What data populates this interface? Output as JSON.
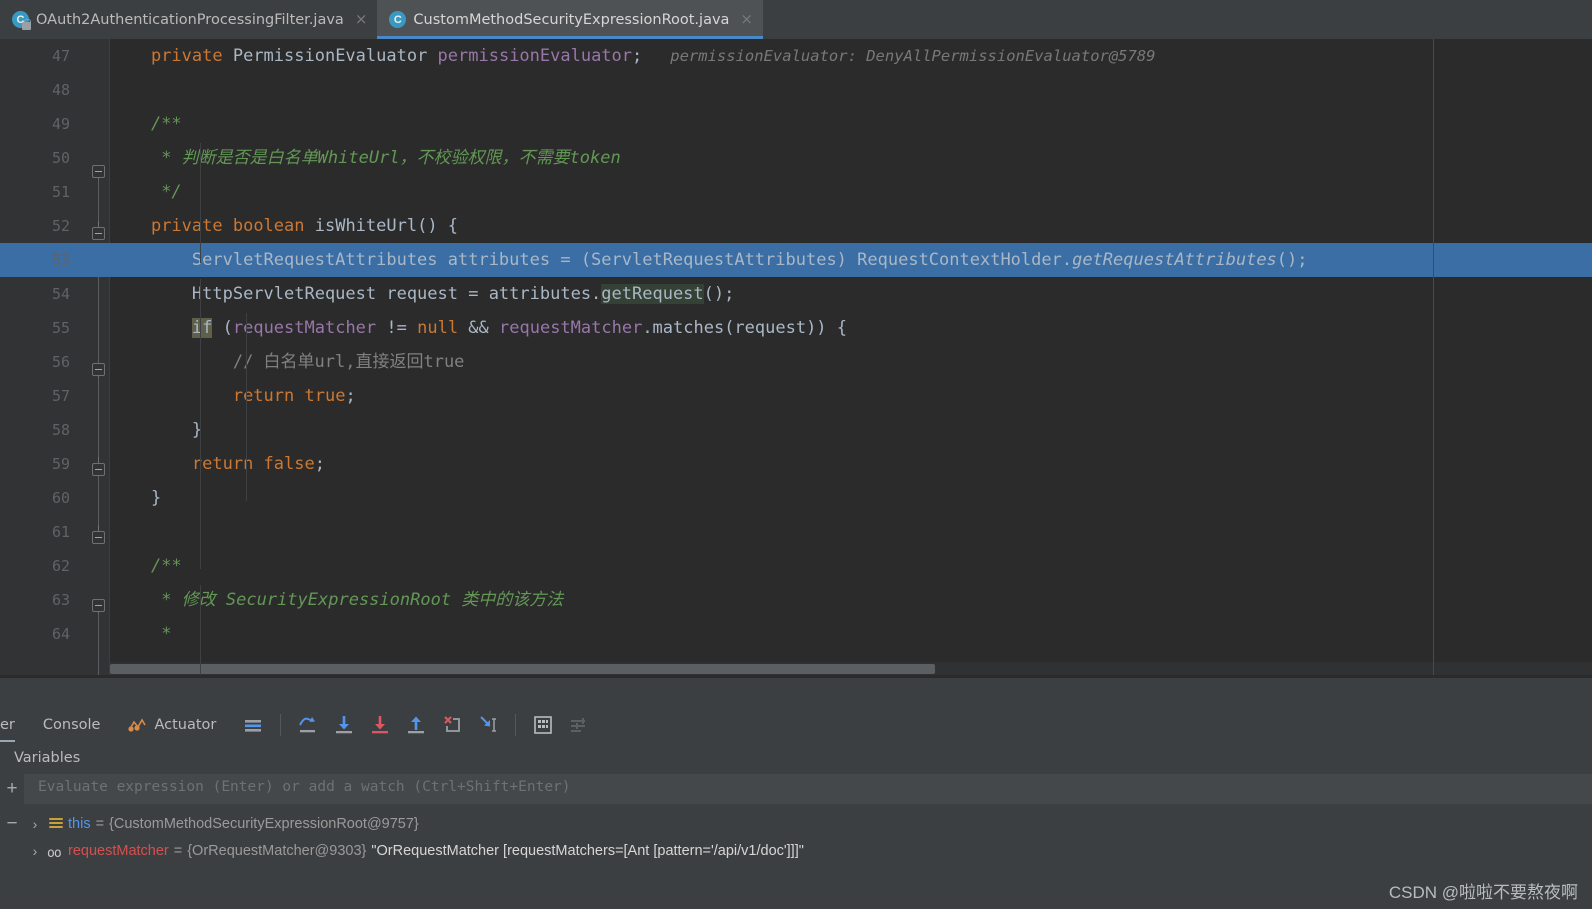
{
  "tabs": [
    {
      "label": "OAuth2AuthenticationProcessingFilter.java",
      "icon": "class-locked-icon",
      "close": "×",
      "active": false
    },
    {
      "label": "CustomMethodSecurityExpressionRoot.java",
      "icon": "class-icon",
      "close": "×",
      "active": true
    }
  ],
  "editor": {
    "current_line": 53,
    "breakpoint_line": 53,
    "inlay_hint_line47": "permissionEvaluator: DenyAllPermissionEvaluator@5789",
    "lines": [
      {
        "no": "47",
        "segments": [
          {
            "t": "private ",
            "c": "kw"
          },
          {
            "t": "PermissionEvaluator ",
            "c": "typ"
          },
          {
            "t": "permissionEvaluator",
            "c": "fld"
          },
          {
            "t": ";",
            "c": "def"
          }
        ],
        "indent": 1
      },
      {
        "no": "48",
        "segments": [],
        "indent": 0
      },
      {
        "no": "49",
        "segments": [
          {
            "t": "/**",
            "c": "cmt"
          }
        ],
        "indent": 1
      },
      {
        "no": "50",
        "segments": [
          {
            "t": " * 判断是否是白名单WhiteUrl，不校验权限，不需要token",
            "c": "cmt"
          }
        ],
        "indent": 1
      },
      {
        "no": "51",
        "segments": [
          {
            "t": " */",
            "c": "cmt"
          }
        ],
        "indent": 1
      },
      {
        "no": "52",
        "segments": [
          {
            "t": "private ",
            "c": "kw"
          },
          {
            "t": "boolean ",
            "c": "kw"
          },
          {
            "t": "isWhiteUrl",
            "c": "def"
          },
          {
            "t": "() {",
            "c": "def"
          }
        ],
        "indent": 1
      },
      {
        "no": "53",
        "segments": [
          {
            "t": "ServletRequestAttributes attributes = (ServletRequestAttributes) RequestContextHolder.",
            "c": "def"
          },
          {
            "t": "getRequestAttributes",
            "c": "mth"
          },
          {
            "t": "();",
            "c": "def"
          }
        ],
        "indent": 2
      },
      {
        "no": "54",
        "segments": [
          {
            "t": "HttpServletRequest request = attributes.",
            "c": "def"
          },
          {
            "t": "getRequest",
            "c": "hl-ident"
          },
          {
            "t": "();",
            "c": "def"
          }
        ],
        "indent": 2
      },
      {
        "no": "55",
        "segments": [
          {
            "t": "if",
            "c": "hl-kw"
          },
          {
            "t": " (",
            "c": "def"
          },
          {
            "t": "requestMatcher",
            "c": "fld"
          },
          {
            "t": " != ",
            "c": "def"
          },
          {
            "t": "null",
            "c": "kw"
          },
          {
            "t": " && ",
            "c": "def"
          },
          {
            "t": "requestMatcher",
            "c": "fld"
          },
          {
            "t": ".matches(request)) {",
            "c": "def"
          }
        ],
        "indent": 2
      },
      {
        "no": "56",
        "segments": [
          {
            "t": "// 白名单url,直接返回true",
            "c": "cmt2"
          }
        ],
        "indent": 3
      },
      {
        "no": "57",
        "segments": [
          {
            "t": "return ",
            "c": "kw"
          },
          {
            "t": "true",
            "c": "kw"
          },
          {
            "t": ";",
            "c": "def"
          }
        ],
        "indent": 3
      },
      {
        "no": "58",
        "segments": [
          {
            "t": "}",
            "c": "def"
          }
        ],
        "indent": 2
      },
      {
        "no": "59",
        "segments": [
          {
            "t": "return ",
            "c": "kw"
          },
          {
            "t": "false",
            "c": "kw"
          },
          {
            "t": ";",
            "c": "def"
          }
        ],
        "indent": 2
      },
      {
        "no": "60",
        "segments": [
          {
            "t": "}",
            "c": "def"
          }
        ],
        "indent": 1
      },
      {
        "no": "61",
        "segments": [],
        "indent": 0
      },
      {
        "no": "62",
        "segments": [
          {
            "t": "/**",
            "c": "cmt"
          }
        ],
        "indent": 1
      },
      {
        "no": "63",
        "segments": [
          {
            "t": " * 修改 SecurityExpressionRoot 类中的该方法",
            "c": "cmt"
          }
        ],
        "indent": 1
      },
      {
        "no": "64",
        "segments": [
          {
            "t": " *",
            "c": "cmt"
          }
        ],
        "indent": 1
      }
    ]
  },
  "debug": {
    "tabs": [
      {
        "label": "er",
        "name": "tab-debugger",
        "selected": true
      },
      {
        "label": "Console",
        "name": "tab-console",
        "selected": false
      },
      {
        "label": "Actuator",
        "name": "tab-actuator",
        "selected": false
      }
    ],
    "toolbar_icons": [
      "show-execution-point-icon",
      "step-over-icon",
      "step-into-icon",
      "force-step-into-icon",
      "step-out-icon",
      "drop-frame-icon",
      "run-to-cursor-icon",
      "evaluate-expression-icon",
      "settings-icon"
    ],
    "variables_tab_label": "Variables",
    "evaluate_placeholder": "Evaluate expression (Enter) or add a watch (Ctrl+Shift+Enter)",
    "add_watch_label": "+",
    "remove_watch_label": "−",
    "variables": [
      {
        "chevron": "›",
        "icon": "object-field-icon",
        "name": "this",
        "eq": "=",
        "value": "{CustomMethodSecurityExpressionRoot@9757}",
        "str": ""
      },
      {
        "chevron": "›",
        "icon": "oo-field-icon",
        "name": "requestMatcher",
        "eq": "=",
        "value": "{OrRequestMatcher@9303}",
        "str": "\"OrRequestMatcher [requestMatchers=[Ant [pattern='/api/v1/doc']]]\""
      }
    ]
  },
  "watermark": "CSDN @啦啦不要熬夜啊",
  "colors": {
    "accent": "#4a88c7",
    "editor_bg": "#2b2b2b",
    "gutter_bg": "#313335",
    "panel_bg": "#3c3f41",
    "exec_line": "#3a6ea5",
    "breakpoint": "#db5860",
    "keyword": "#cc7832",
    "field": "#9876aa",
    "comment": "#629755",
    "string": "#6a8759"
  }
}
